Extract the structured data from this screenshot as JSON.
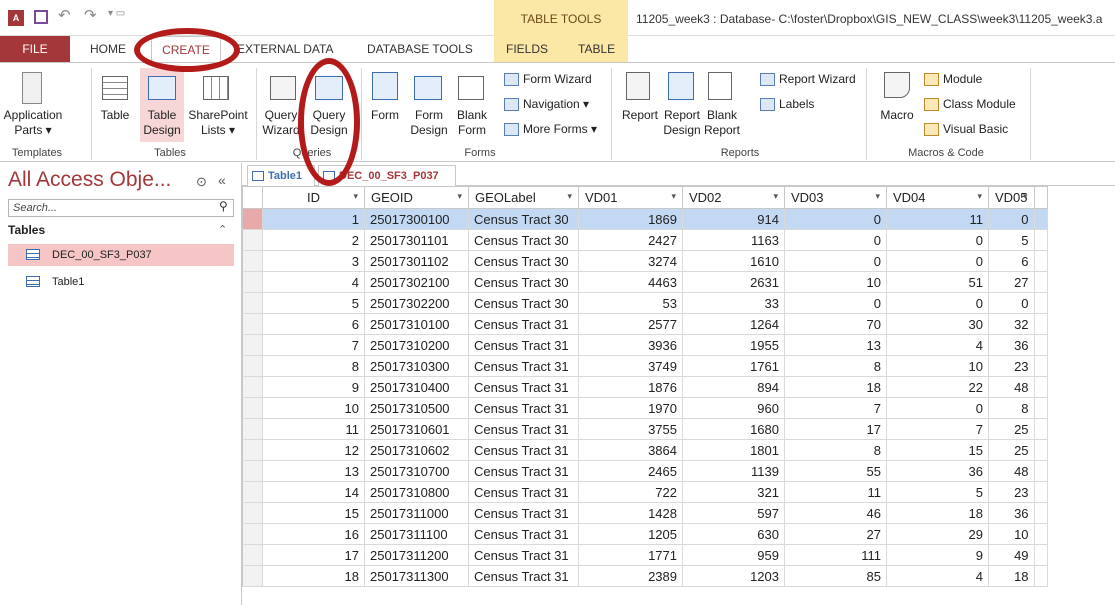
{
  "titlebar": {
    "app_icon": "access-icon",
    "quick_access": [
      "save-icon",
      "undo-icon",
      "redo-icon"
    ],
    "context_title": "TABLE TOOLS",
    "document_title": "11205_week3 : Database- C:\\foster\\Dropbox\\GIS_NEW_CLASS\\week3\\11205_week3.a"
  },
  "tabs": {
    "file": "FILE",
    "home": "HOME",
    "create": "CREATE",
    "external": "EXTERNAL DATA",
    "dbtools": "DATABASE TOOLS",
    "fields": "FIELDS",
    "table": "TABLE"
  },
  "ribbon": {
    "templates": {
      "label": "Templates",
      "app_parts": "Application\nParts ▾"
    },
    "tables": {
      "label": "Tables",
      "table": "Table",
      "table_design": "Table\nDesign",
      "sharepoint": "SharePoint\nLists ▾"
    },
    "queries": {
      "label": "Queries",
      "query_wizard": "Query\nWizard",
      "query_design": "Query\nDesign"
    },
    "forms": {
      "label": "Forms",
      "form": "Form",
      "form_design": "Form\nDesign",
      "blank_form": "Blank\nForm",
      "form_wizard": "Form Wizard",
      "navigation": "Navigation ▾",
      "more_forms": "More Forms ▾"
    },
    "reports": {
      "label": "Reports",
      "report": "Report",
      "report_design": "Report\nDesign",
      "blank_report": "Blank\nReport",
      "report_wizard": "Report Wizard",
      "labels": "Labels"
    },
    "macros": {
      "label": "Macros & Code",
      "macro": "Macro",
      "module": "Module",
      "class_module": "Class Module",
      "visual_basic": "Visual Basic"
    }
  },
  "nav": {
    "title": "All Access Obje...",
    "search_placeholder": "Search...",
    "section": "Tables",
    "items": [
      "DEC_00_SF3_P037",
      "Table1"
    ]
  },
  "doc_tabs": [
    "Table1",
    "DEC_00_SF3_P037"
  ],
  "grid": {
    "columns": [
      "ID",
      "GEOID",
      "GEOLabel",
      "VD01",
      "VD02",
      "VD03",
      "VD04",
      "VD05"
    ],
    "rows": [
      [
        "1",
        "25017300100",
        "Census Tract 30",
        "1869",
        "914",
        "0",
        "11",
        "0"
      ],
      [
        "2",
        "25017301101",
        "Census Tract 30",
        "2427",
        "1163",
        "0",
        "0",
        "5"
      ],
      [
        "3",
        "25017301102",
        "Census Tract 30",
        "3274",
        "1610",
        "0",
        "0",
        "6"
      ],
      [
        "4",
        "25017302100",
        "Census Tract 30",
        "4463",
        "2631",
        "10",
        "51",
        "27"
      ],
      [
        "5",
        "25017302200",
        "Census Tract 30",
        "53",
        "33",
        "0",
        "0",
        "0"
      ],
      [
        "6",
        "25017310100",
        "Census Tract 31",
        "2577",
        "1264",
        "70",
        "30",
        "32"
      ],
      [
        "7",
        "25017310200",
        "Census Tract 31",
        "3936",
        "1955",
        "13",
        "4",
        "36"
      ],
      [
        "8",
        "25017310300",
        "Census Tract 31",
        "3749",
        "1761",
        "8",
        "10",
        "23"
      ],
      [
        "9",
        "25017310400",
        "Census Tract 31",
        "1876",
        "894",
        "18",
        "22",
        "48"
      ],
      [
        "10",
        "25017310500",
        "Census Tract 31",
        "1970",
        "960",
        "7",
        "0",
        "8"
      ],
      [
        "11",
        "25017310601",
        "Census Tract 31",
        "3755",
        "1680",
        "17",
        "7",
        "25"
      ],
      [
        "12",
        "25017310602",
        "Census Tract 31",
        "3864",
        "1801",
        "8",
        "15",
        "25"
      ],
      [
        "13",
        "25017310700",
        "Census Tract 31",
        "2465",
        "1139",
        "55",
        "36",
        "48"
      ],
      [
        "14",
        "25017310800",
        "Census Tract 31",
        "722",
        "321",
        "11",
        "5",
        "23"
      ],
      [
        "15",
        "25017311000",
        "Census Tract 31",
        "1428",
        "597",
        "46",
        "18",
        "36"
      ],
      [
        "16",
        "25017311100",
        "Census Tract 31",
        "1205",
        "630",
        "27",
        "29",
        "10"
      ],
      [
        "17",
        "25017311200",
        "Census Tract 31",
        "1771",
        "959",
        "111",
        "9",
        "49"
      ],
      [
        "18",
        "25017311300",
        "Census Tract 31",
        "2389",
        "1203",
        "85",
        "4",
        "18"
      ]
    ]
  },
  "colors": {
    "access_red": "#a4373a",
    "annotation": "#b31b1b",
    "selected_row": "#c3d9f3",
    "context_tab": "#fbe7a6"
  }
}
